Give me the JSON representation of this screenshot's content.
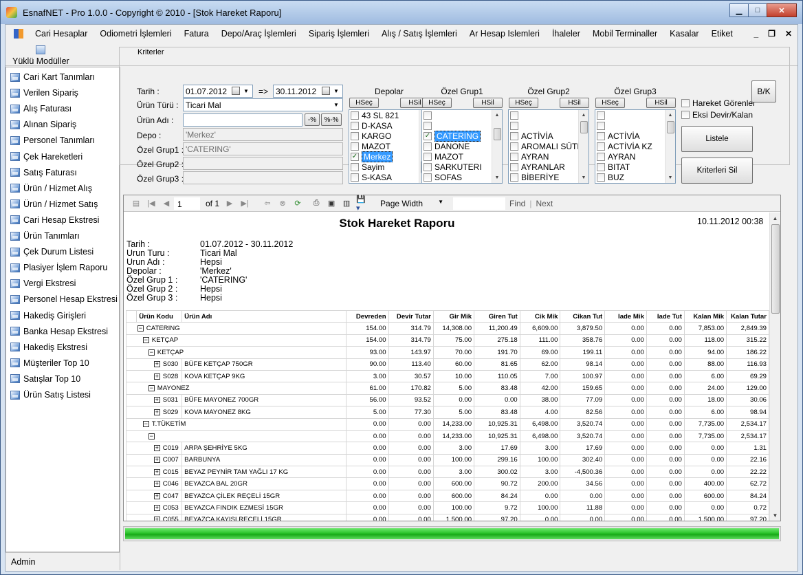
{
  "window": {
    "title": "EsnafNET - Pro 1.0.0 - Copyright ©  2010 - [Stok Hareket Raporu]"
  },
  "menu": [
    "Cari Hesaplar",
    "Odiometri İşlemleri",
    "Fatura",
    "Depo/Araç İşlemleri",
    "Sipariş İşlemleri",
    "Alış / Satış İşlemleri",
    "Ar Hesap Islemleri",
    "İhaleler",
    "Mobil Terminaller",
    "Kasalar",
    "Etiket"
  ],
  "modules_label": "Yüklü Modüller",
  "sidebar": [
    "Cari Kart Tanımları",
    "Verilen Sipariş",
    "Alış Faturası",
    "Alınan Sipariş",
    "Personel Tanımları",
    "Çek Hareketleri",
    "Satış Faturası",
    "Ürün / Hizmet Alış",
    "Ürün / Hizmet Satış",
    "Cari Hesap Ekstresi",
    "Ürün Tanımları",
    "Çek Durum Listesi",
    "Plasiyer İşlem Raporu",
    "Vergi Ekstresi",
    "Personel Hesap Ekstresi",
    "Hakediş Girişleri",
    "Banka Hesap Ekstresi",
    "Hakediş Ekstresi",
    "Müşteriler Top 10",
    "Satışlar Top 10",
    "Ürün Satış Listesi"
  ],
  "status": "Admin",
  "criteria": {
    "title": "Kriterler",
    "tarih_label": "Tarih :",
    "tarih_from": "01.07.2012",
    "arrow": "=>",
    "tarih_to": "30.11.2012",
    "urun_turu_label": "Ürün Türü :",
    "urun_turu": "Ticari Mal",
    "urun_adi_label": "Ürün Adı :",
    "pct_btn": "-%",
    "pctpct_btn": "%-%",
    "depo_label": "Depo :",
    "depo": "'Merkez'",
    "oz1_label": "Özel Grup1 :",
    "oz1": "'CATERING'",
    "oz2_label": "Özel Grup2 :",
    "oz3_label": "Özel Grup3 :",
    "hsec": "HSeç",
    "hsil": "HSil",
    "lists": [
      {
        "title": "Depolar",
        "items": [
          {
            "t": "43 SL 821",
            "c": false
          },
          {
            "t": "D-KASA",
            "c": false
          },
          {
            "t": "KARGO",
            "c": false
          },
          {
            "t": "MAZOT",
            "c": false
          },
          {
            "t": "Merkez",
            "c": true,
            "sel": true
          },
          {
            "t": "Sayim",
            "c": false
          },
          {
            "t": "S-KASA",
            "c": false
          }
        ]
      },
      {
        "title": "Özel Grup1",
        "items": [
          {
            "t": "",
            "c": false
          },
          {
            "t": "",
            "c": false
          },
          {
            "t": "CATERING",
            "c": true,
            "sel": true
          },
          {
            "t": "DANONE",
            "c": false
          },
          {
            "t": "MAZOT",
            "c": false
          },
          {
            "t": "SARKUTERI",
            "c": false
          },
          {
            "t": "SOFAS",
            "c": false
          }
        ]
      },
      {
        "title": "Özel Grup2",
        "items": [
          {
            "t": "",
            "c": false
          },
          {
            "t": "",
            "c": false
          },
          {
            "t": "ACTİVİA",
            "c": false
          },
          {
            "t": "AROMALI SÜTL",
            "c": false
          },
          {
            "t": "AYRAN",
            "c": false
          },
          {
            "t": "AYRANLAR",
            "c": false
          },
          {
            "t": "BİBERİYE",
            "c": false
          }
        ]
      },
      {
        "title": "Özel Grup3",
        "items": [
          {
            "t": "",
            "c": false
          },
          {
            "t": "",
            "c": false
          },
          {
            "t": "ACTİVİA",
            "c": false
          },
          {
            "t": "ACTİVİA KZ",
            "c": false
          },
          {
            "t": "AYRAN",
            "c": false
          },
          {
            "t": "BITAT",
            "c": false
          },
          {
            "t": "BUZ",
            "c": false
          }
        ]
      }
    ],
    "hareket_gorenler": "Hareket Görenler",
    "eksi_devir": "Eksi Devir/Kalan",
    "bk_btn": "B/K",
    "listele_btn": "Listele",
    "kriterleri_sil_btn": "Kriterleri Sil"
  },
  "viewer": {
    "page": "1",
    "of": "of 1",
    "zoom": "Page Width",
    "find": "Find",
    "sep": "|",
    "next": "Next"
  },
  "report": {
    "title": "Stok Hareket Raporu",
    "date": "10.11.2012 00:38",
    "criteria": [
      {
        "k": "Tarih :",
        "v": "01.07.2012 - 30.11.2012"
      },
      {
        "k": "Urun Turu :",
        "v": "Ticari Mal"
      },
      {
        "k": "Urun Adı :",
        "v": "Hepsi"
      },
      {
        "k": "Depolar :",
        "v": "'Merkez'"
      },
      {
        "k": "Özel Grup 1 :",
        "v": "'CATERING'"
      },
      {
        "k": "Özel Grup 2 :",
        "v": "Hepsi"
      },
      {
        "k": "Özel Grup 3 :",
        "v": "Hepsi"
      }
    ],
    "headers": [
      "Ürün Kodu",
      "Ürün Adı",
      "Devreden",
      "Devir Tutar",
      "Gir Mik",
      "Giren Tut",
      "Cik Mik",
      "Cikan Tut",
      "Iade Mik",
      "Iade Tut",
      "Kalan Mik",
      "Kalan Tutar"
    ],
    "rows": [
      {
        "lvl": 0,
        "sign": "−",
        "code": "CATERING",
        "name": "",
        "v": [
          "154.00",
          "314.79",
          "14,308.00",
          "11,200.49",
          "6,609.00",
          "3,879.50",
          "0.00",
          "0.00",
          "7,853.00",
          "2,849.39"
        ]
      },
      {
        "lvl": 1,
        "sign": "−",
        "code": "KETÇAP",
        "name": "",
        "v": [
          "154.00",
          "314.79",
          "75.00",
          "275.18",
          "111.00",
          "358.76",
          "0.00",
          "0.00",
          "118.00",
          "315.22"
        ]
      },
      {
        "lvl": 2,
        "sign": "−",
        "code": "KETÇAP",
        "name": "",
        "v": [
          "93.00",
          "143.97",
          "70.00",
          "191.70",
          "69.00",
          "199.11",
          "0.00",
          "0.00",
          "94.00",
          "186.22"
        ]
      },
      {
        "lvl": 3,
        "sign": "+",
        "code": "S030",
        "name": "BÜFE KETÇAP 750GR",
        "v": [
          "90.00",
          "113.40",
          "60.00",
          "81.65",
          "62.00",
          "98.14",
          "0.00",
          "0.00",
          "88.00",
          "116.93"
        ]
      },
      {
        "lvl": 3,
        "sign": "+",
        "code": "S028",
        "name": "KOVA KETÇAP 9KG",
        "v": [
          "3.00",
          "30.57",
          "10.00",
          "110.05",
          "7.00",
          "100.97",
          "0.00",
          "0.00",
          "6.00",
          "69.29"
        ]
      },
      {
        "lvl": 2,
        "sign": "−",
        "code": "MAYONEZ",
        "name": "",
        "v": [
          "61.00",
          "170.82",
          "5.00",
          "83.48",
          "42.00",
          "159.65",
          "0.00",
          "0.00",
          "24.00",
          "129.00"
        ]
      },
      {
        "lvl": 3,
        "sign": "+",
        "code": "S031",
        "name": "BÜFE MAYONEZ 700GR",
        "v": [
          "56.00",
          "93.52",
          "0.00",
          "0.00",
          "38.00",
          "77.09",
          "0.00",
          "0.00",
          "18.00",
          "30.06"
        ]
      },
      {
        "lvl": 3,
        "sign": "+",
        "code": "S029",
        "name": "KOVA MAYONEZ 8KG",
        "v": [
          "5.00",
          "77.30",
          "5.00",
          "83.48",
          "4.00",
          "82.56",
          "0.00",
          "0.00",
          "6.00",
          "98.94"
        ]
      },
      {
        "lvl": 1,
        "sign": "−",
        "code": "T.TÜKETİM",
        "name": "",
        "v": [
          "0.00",
          "0.00",
          "14,233.00",
          "10,925.31",
          "6,498.00",
          "3,520.74",
          "0.00",
          "0.00",
          "7,735.00",
          "2,534.17"
        ]
      },
      {
        "lvl": 2,
        "sign": "−",
        "code": "",
        "name": "",
        "v": [
          "0.00",
          "0.00",
          "14,233.00",
          "10,925.31",
          "6,498.00",
          "3,520.74",
          "0.00",
          "0.00",
          "7,735.00",
          "2,534.17"
        ]
      },
      {
        "lvl": 3,
        "sign": "+",
        "code": "C019",
        "name": "ARPA ŞEHRİYE 5KG",
        "v": [
          "0.00",
          "0.00",
          "3.00",
          "17.69",
          "3.00",
          "17.69",
          "0.00",
          "0.00",
          "0.00",
          "1.31"
        ]
      },
      {
        "lvl": 3,
        "sign": "+",
        "code": "C007",
        "name": "BARBUNYA",
        "v": [
          "0.00",
          "0.00",
          "100.00",
          "299.16",
          "100.00",
          "302.40",
          "0.00",
          "0.00",
          "0.00",
          "22.16"
        ]
      },
      {
        "lvl": 3,
        "sign": "+",
        "code": "C015",
        "name": "BEYAZ PEYNİR TAM YAĞLI 17 KG",
        "v": [
          "0.00",
          "0.00",
          "3.00",
          "300.02",
          "3.00",
          "-4,500.36",
          "0.00",
          "0.00",
          "0.00",
          "22.22"
        ]
      },
      {
        "lvl": 3,
        "sign": "+",
        "code": "C046",
        "name": "BEYAZCA BAL 20GR",
        "v": [
          "0.00",
          "0.00",
          "600.00",
          "90.72",
          "200.00",
          "34.56",
          "0.00",
          "0.00",
          "400.00",
          "62.72"
        ]
      },
      {
        "lvl": 3,
        "sign": "+",
        "code": "C047",
        "name": "BEYAZCA ÇİLEK REÇELİ 15GR",
        "v": [
          "0.00",
          "0.00",
          "600.00",
          "84.24",
          "0.00",
          "0.00",
          "0.00",
          "0.00",
          "600.00",
          "84.24"
        ]
      },
      {
        "lvl": 3,
        "sign": "+",
        "code": "C053",
        "name": "BEYAZCA FINDIK EZMESİ 15GR",
        "v": [
          "0.00",
          "0.00",
          "100.00",
          "9.72",
          "100.00",
          "11.88",
          "0.00",
          "0.00",
          "0.00",
          "0.72"
        ]
      },
      {
        "lvl": 3,
        "sign": "+",
        "code": "C055",
        "name": "BEYAZCA KAYISI REÇELİ 15GR",
        "v": [
          "0.00",
          "0.00",
          "1,500.00",
          "97.20",
          "0.00",
          "0.00",
          "0.00",
          "0.00",
          "1,500.00",
          "97.20"
        ]
      }
    ]
  },
  "progress": 1.0
}
